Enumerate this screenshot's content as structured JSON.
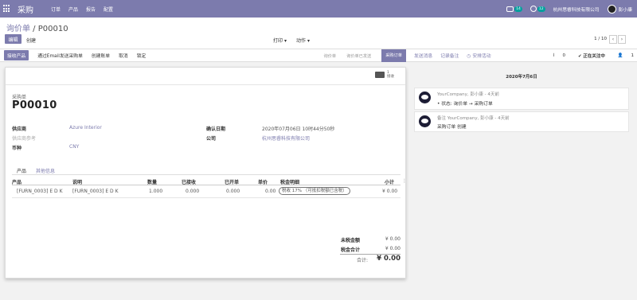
{
  "navbar": {
    "app_name": "采购",
    "menu": [
      "订单",
      "产品",
      "报告",
      "配置"
    ],
    "chat_badge": "14",
    "activity_badge": "12",
    "company": "杭州思睿科技有限公司",
    "user": "彭小康"
  },
  "breadcrumb": {
    "parent": "询价单",
    "separator": " / ",
    "current": "P00010"
  },
  "buttons": {
    "edit": "编辑",
    "create": "创建",
    "print": "打印",
    "action": "动作",
    "pager": "1 / 10",
    "prev": "‹",
    "next": "›"
  },
  "statusbar": {
    "actions": [
      "接收产品",
      "通过Email发送采购单",
      "创建账单",
      "取消",
      "锁定"
    ],
    "stages": [
      "询价单",
      "询价单已发送",
      "采购订单"
    ],
    "active_stage": "采购订单"
  },
  "chatter_top": {
    "send_message": "发送消息",
    "log_note": "记录备注",
    "schedule": "安排活动",
    "attachments": "0",
    "follow": "正在关注中",
    "followers": "1"
  },
  "form": {
    "smart_button": {
      "count": "1",
      "label": "接收"
    },
    "subtitle": "采购单",
    "name": "P00010",
    "vendor_label": "供应商",
    "vendor_value": "Azure Interior",
    "vendor_ref_label": "供应商参考",
    "currency_label": "币种",
    "currency_value": "CNY",
    "order_date_label": "确认日期",
    "order_date_value": "2020年07月06日 10时44分50秒",
    "company_label": "公司",
    "company_value": "杭州思睿科技有限公司",
    "tabs": [
      "产品",
      "其他信息"
    ],
    "columns": [
      "产品",
      "说明",
      "数量",
      "已接收",
      "已开单",
      "单价",
      "税金明细",
      "小计"
    ],
    "lines": [
      {
        "product": "[FURN_0003] E D K",
        "description": "[FURN_0003] E D K",
        "qty": "1.000",
        "received": "0.000",
        "billed": "0.000",
        "price": "0.00",
        "tax": "税收 17% （可抵扣税额已含税）",
        "subtotal": "¥ 0.00"
      }
    ],
    "untaxed_label": "未税金额",
    "untaxed_value": "¥ 0.00",
    "tax_label": "税金合计",
    "tax_value": "¥ 0.00",
    "total_label": "合计:",
    "total_value": "¥ 0.00"
  },
  "chatter": {
    "date": "2020年7月6日",
    "messages": [
      {
        "author": "YourCompany, 彭小康 - 4天前",
        "body": "• 状态: 询价单 → 采购订单"
      },
      {
        "author": "备注 YourCompany, 彭小康 - 4天前",
        "body": "采购订单 创建"
      }
    ]
  }
}
